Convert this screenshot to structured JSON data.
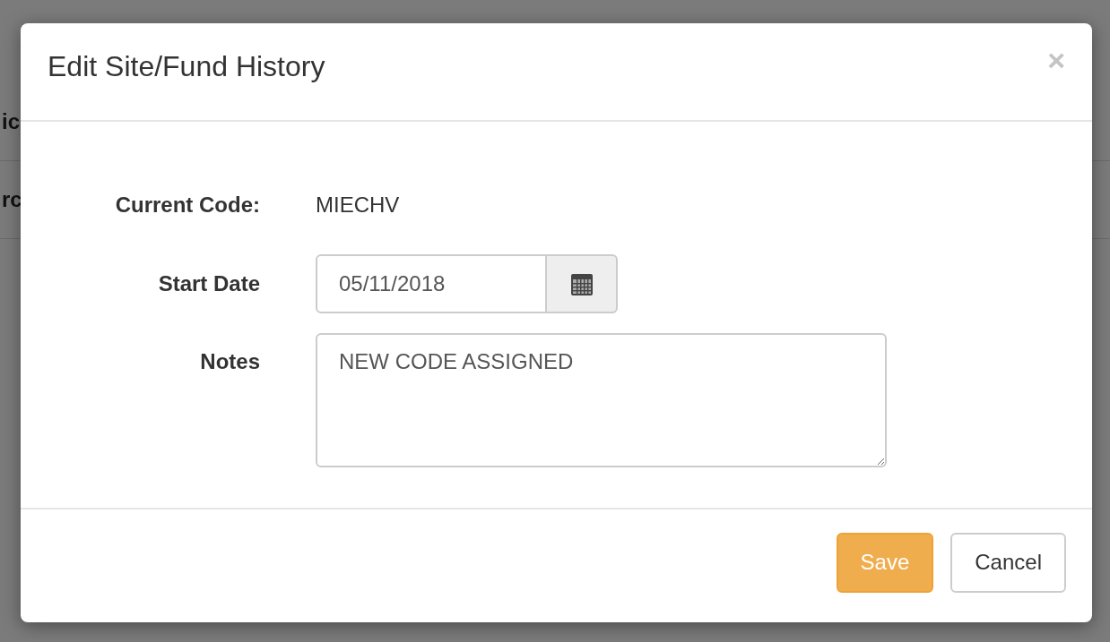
{
  "background": {
    "fragments": [
      "ic",
      "rc"
    ]
  },
  "dialog": {
    "title": "Edit Site/Fund History",
    "close": "×",
    "fields": [
      {
        "kind": "static",
        "label": "Current Code:",
        "value": "MIECHV"
      },
      {
        "kind": "date",
        "label": "Start Date",
        "value": "05/11/2018"
      },
      {
        "kind": "textarea",
        "label": "Notes",
        "value": "NEW CODE ASSIGNED"
      }
    ],
    "buttons": [
      {
        "label": "Save",
        "kind": "primary"
      },
      {
        "label": "Cancel",
        "kind": "default"
      }
    ]
  }
}
